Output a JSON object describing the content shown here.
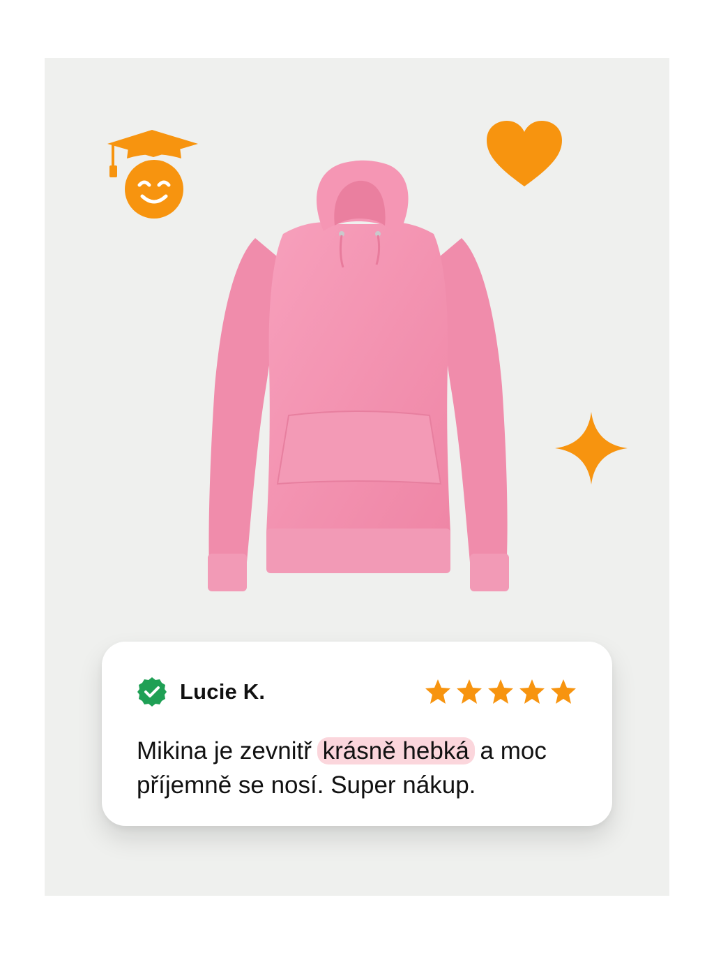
{
  "colors": {
    "background": "#eff0ee",
    "accent_orange": "#f7940f",
    "hoodie_pink": "#f493b0",
    "verified_green": "#1fa055",
    "highlight_pink": "#fbd6dc"
  },
  "decorations": {
    "top_left_icon": "graduation-cap-smiley-icon",
    "top_right_icon": "heart-icon",
    "right_icon": "sparkle-icon",
    "product_image": "pink-hoodie"
  },
  "review": {
    "verified_icon": "verified-check-icon",
    "author": "Lucie K.",
    "rating": 5,
    "rating_max": 5,
    "text_before": "Mikina je zevnitř",
    "text_highlight": "krásně hebká",
    "text_after": "a moc příjemně se nosí. Super nákup."
  }
}
